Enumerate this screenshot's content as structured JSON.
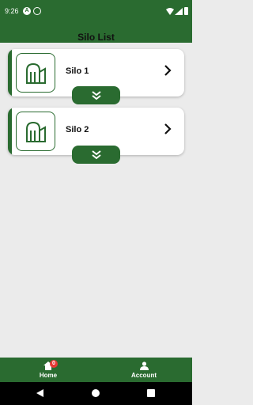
{
  "status_bar": {
    "time": "9:26",
    "icon_a": "A"
  },
  "header": {
    "title": "Silo List"
  },
  "silos": [
    {
      "name": "Silo 1"
    },
    {
      "name": "Silo 2"
    }
  ],
  "bottom_nav": {
    "home_label": "Home",
    "home_badge": "0",
    "account_label": "Account"
  },
  "colors": {
    "primary": "#2a6b30",
    "background": "#ebebeb",
    "badge": "#e53935"
  }
}
